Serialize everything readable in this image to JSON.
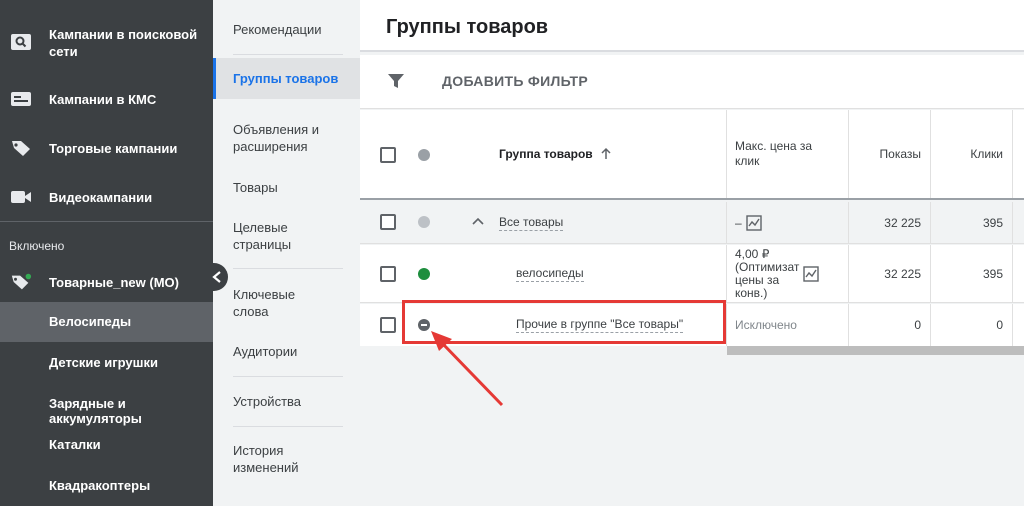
{
  "sidebar": {
    "items": [
      {
        "label": "Кампании в поисковой сети",
        "icon": "search-icon"
      },
      {
        "label": "Кампании в КМС",
        "icon": "display-icon"
      },
      {
        "label": "Торговые кампании",
        "icon": "tag-icon"
      },
      {
        "label": "Видеокампании",
        "icon": "video-icon"
      }
    ],
    "section_label": "Включено",
    "campaign": {
      "label": "Товарные_new (МО)",
      "icon": "tag-icon",
      "status_color": "#34a853"
    },
    "ad_groups": [
      "Велосипеды",
      "Детские игрушки",
      "Зарядные и аккумуляторы",
      "Каталки",
      "Квадракоптеры"
    ]
  },
  "subnav": {
    "items": [
      "Рекомендации",
      "Группы товаров",
      "Объявления и расширения",
      "Товары",
      "Целевые страницы",
      "Ключевые слова",
      "Аудитории",
      "Устройства",
      "История изменений"
    ]
  },
  "page": {
    "title": "Группы товаров",
    "filter_label": "ДОБАВИТЬ ФИЛЬТР"
  },
  "table": {
    "headers": {
      "group": "Группа товаров",
      "max_cpc": "Макс. цена за клик",
      "impressions": "Показы",
      "clicks": "Клики"
    },
    "rows": [
      {
        "name": "Все товары",
        "cpc": "–",
        "impressions": "32 225",
        "clicks": "395",
        "status": "grey"
      },
      {
        "name": "велосипеды",
        "cpc": "4,00 ₽ (Оптимизат цены за конв.)",
        "impressions": "32 225",
        "clicks": "395",
        "status": "green"
      },
      {
        "name": "Прочие в группе \"Все товары\"",
        "cpc": "Исключено",
        "impressions": "0",
        "clicks": "0",
        "status": "excluded"
      }
    ]
  },
  "colors": {
    "accent": "#1a73e8",
    "highlight": "#e53935",
    "enabled": "#1e8e3e"
  }
}
